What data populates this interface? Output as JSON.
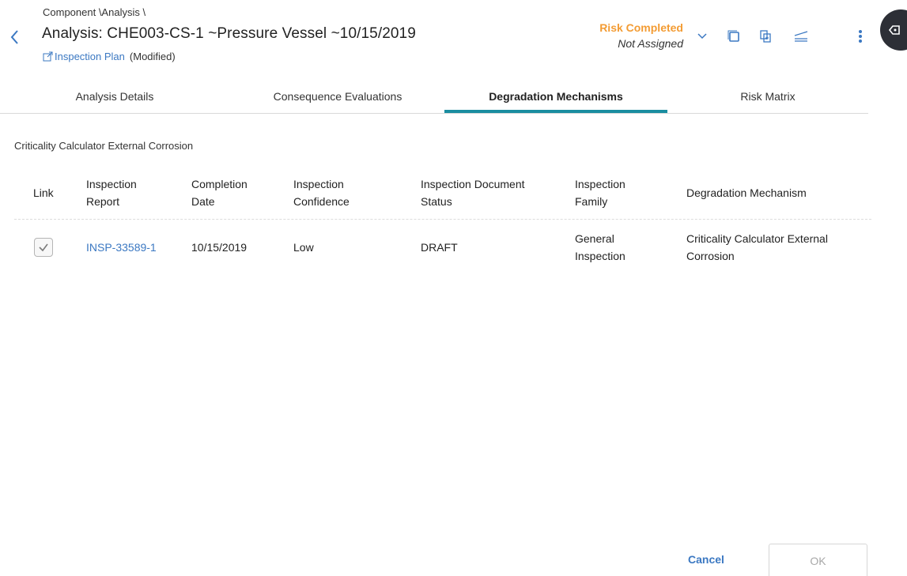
{
  "header": {
    "breadcrumb": "Component \\Analysis \\",
    "title": "Analysis: CHE003-CS-1 ~Pressure Vessel ~10/15/2019",
    "plan_link": "Inspection Plan",
    "modified": "(Modified)",
    "status_state": "Risk Completed",
    "status_assignee": "Not Assigned",
    "icons": [
      "chevron-down-icon",
      "copy-icon",
      "export-icon",
      "compare-icon",
      "more-vertical-icon",
      "side-panel-icon"
    ],
    "colors": {
      "status": "#f39c34",
      "link": "#3b78c2",
      "accent": "#1a8da0"
    }
  },
  "tabs": [
    {
      "label": "Analysis Details",
      "active": false
    },
    {
      "label": "Consequence Evaluations",
      "active": false
    },
    {
      "label": "Degradation Mechanisms",
      "active": true
    },
    {
      "label": "Risk Matrix",
      "active": false
    }
  ],
  "section": {
    "title": "Criticality Calculator External Corrosion"
  },
  "table": {
    "columns": [
      "Link",
      "Inspection Report",
      "Completion Date",
      "Inspection Confidence",
      "Inspection Document Status",
      "Inspection Family",
      "Degradation Mechanism"
    ],
    "rows": [
      {
        "link_checked": true,
        "inspection_report": "INSP-33589-1",
        "completion_date": "10/15/2019",
        "inspection_confidence": "Low",
        "document_status": "DRAFT",
        "inspection_family": "General Inspection",
        "degradation_mechanism": "Criticality Calculator External Corrosion"
      }
    ]
  },
  "footer": {
    "cancel_label": "Cancel",
    "ok_label": "OK"
  }
}
